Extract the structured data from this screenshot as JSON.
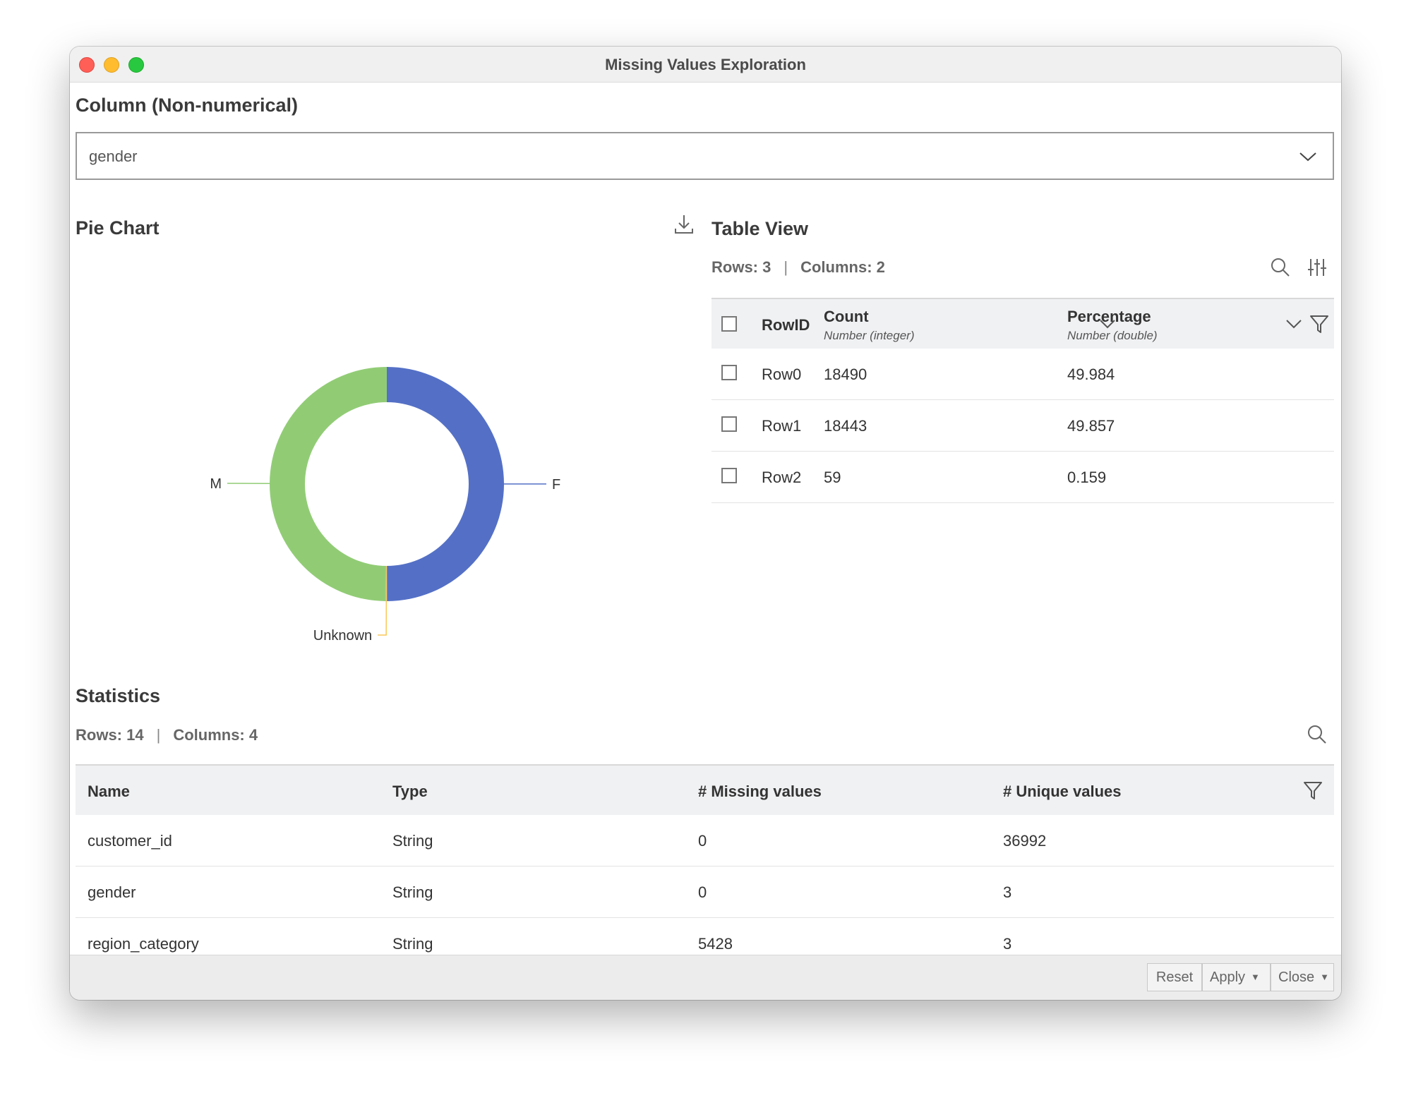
{
  "window": {
    "title": "Missing Values Exploration"
  },
  "column_section": {
    "title": "Column (Non-numerical)",
    "selected": "gender"
  },
  "pie_section": {
    "title": "Pie Chart",
    "slices": [
      {
        "label": "F",
        "value": 49.984,
        "color": "#5470c6"
      },
      {
        "label": "Unknown",
        "value": 0.159,
        "color": "#fac858"
      },
      {
        "label": "M",
        "value": 49.857,
        "color": "#91cc75"
      }
    ]
  },
  "table_view": {
    "title": "Table View",
    "rows_label": "Rows: 3",
    "sep": "|",
    "columns_label": "Columns: 2",
    "header": {
      "rowid": "RowID",
      "col1": "Count",
      "col1_type": "Number (integer)",
      "col2": "Percentage",
      "col2_type": "Number (double)"
    },
    "rows": [
      {
        "id": "Row0",
        "count": "18490",
        "pct": "49.984"
      },
      {
        "id": "Row1",
        "count": "18443",
        "pct": "49.857"
      },
      {
        "id": "Row2",
        "count": "59",
        "pct": "0.159"
      }
    ]
  },
  "statistics": {
    "title": "Statistics",
    "rows_label": "Rows: 14",
    "sep": "|",
    "columns_label": "Columns: 4",
    "headers": [
      "Name",
      "Type",
      "# Missing values",
      "# Unique values"
    ],
    "rows": [
      [
        "customer_id",
        "String",
        "0",
        "36992"
      ],
      [
        "gender",
        "String",
        "0",
        "3"
      ],
      [
        "region_category",
        "String",
        "5428",
        "3"
      ]
    ]
  },
  "footer": {
    "reset": "Reset",
    "apply": "Apply",
    "close": "Close"
  }
}
